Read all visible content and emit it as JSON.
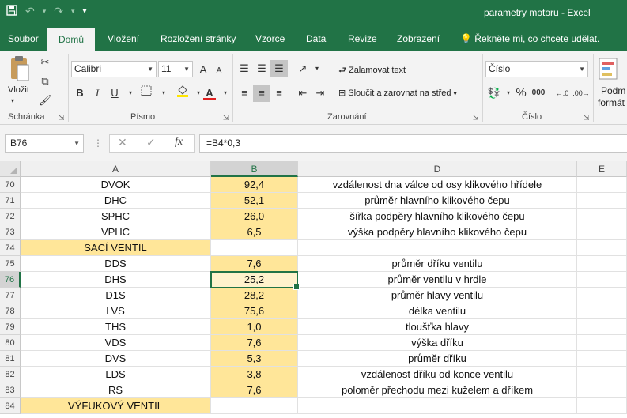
{
  "titlebar": {
    "title": "parametry motoru  -  Excel",
    "save_icon": "floppy-disk-icon",
    "undo_icon": "undo-icon",
    "redo_icon": "redo-icon",
    "customize_icon": "chevron-down-icon"
  },
  "tabs": [
    "Soubor",
    "Domů",
    "Vložení",
    "Rozložení stránky",
    "Vzorce",
    "Data",
    "Revize",
    "Zobrazení"
  ],
  "active_tab": "Domů",
  "tell_me": "Řekněte mi, co chcete udělat.",
  "ribbon": {
    "clipboard": {
      "label": "Schránka",
      "paste": "Vložit"
    },
    "font": {
      "label": "Písmo",
      "name": "Calibri",
      "size": "11",
      "bold": "B",
      "italic": "I",
      "underline": "U",
      "grow": "A",
      "shrink": "A",
      "color_letter": "A"
    },
    "alignment": {
      "label": "Zarovnání",
      "wrap": "Zalamovat text",
      "merge": "Sloučit a zarovnat na střed"
    },
    "number": {
      "label": "Číslo",
      "format": "Číslo",
      "percent": "%",
      "thousands": "000"
    },
    "styles": {
      "line1": "Podm",
      "line2": "formát"
    }
  },
  "formula_bar": {
    "name_box": "B76",
    "formula": "=B4*0,3",
    "fx": "fx",
    "cancel": "✕",
    "enter": "✓"
  },
  "grid": {
    "columns": [
      "A",
      "B",
      "D",
      "E"
    ],
    "selected_column": "B",
    "selected_row": "76",
    "rows": [
      {
        "num": "70",
        "a": "DVOK",
        "b": "92,4",
        "d": "vzdálenost dna válce od osy klikového hřídele"
      },
      {
        "num": "71",
        "a": "DHC",
        "b": "52,1",
        "d": "průměr hlavního klikového čepu"
      },
      {
        "num": "72",
        "a": "SPHC",
        "b": "26,0",
        "d": "šířka podpěry hlavního klikového čepu"
      },
      {
        "num": "73",
        "a": "VPHC",
        "b": "6,5",
        "d": "výška podpěry hlavního klikového čepu"
      },
      {
        "num": "74",
        "a": "SACÍ VENTIL",
        "b": "",
        "d": "",
        "section": true
      },
      {
        "num": "75",
        "a": "DDS",
        "b": "7,6",
        "d": "průměr dříku ventilu"
      },
      {
        "num": "76",
        "a": "DHS",
        "b": "25,2",
        "d": "průměr ventilu v hrdle"
      },
      {
        "num": "77",
        "a": "D1S",
        "b": "28,2",
        "d": "průměr hlavy ventilu"
      },
      {
        "num": "78",
        "a": "LVS",
        "b": "75,6",
        "d": "délka ventilu"
      },
      {
        "num": "79",
        "a": "THS",
        "b": "1,0",
        "d": "tloušťka hlavy"
      },
      {
        "num": "80",
        "a": "VDS",
        "b": "7,6",
        "d": "výška dříku"
      },
      {
        "num": "81",
        "a": "DVS",
        "b": "5,3",
        "d": "průměr dříku"
      },
      {
        "num": "82",
        "a": "LDS",
        "b": "3,8",
        "d": "vzdálenost dříku od konce ventilu"
      },
      {
        "num": "83",
        "a": "RS",
        "b": "7,6",
        "d": "poloměr přechodu mezi kuželem a dříkem"
      },
      {
        "num": "84",
        "a": "VÝFUKOVÝ VENTIL",
        "b": "",
        "d": "",
        "section": true
      }
    ]
  },
  "colors": {
    "excel_green": "#217346",
    "cell_yellow": "#ffe699",
    "active_cell": "#fff2cc"
  }
}
